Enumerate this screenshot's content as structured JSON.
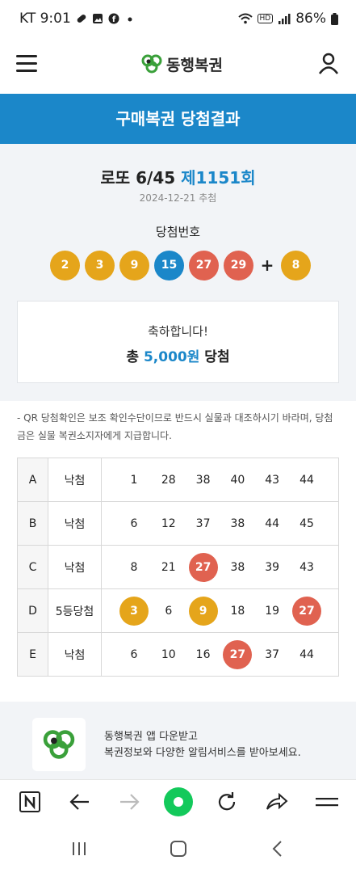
{
  "status_bar": {
    "carrier_time": "KT 9:01",
    "battery": "86%",
    "hd": "HD"
  },
  "header": {
    "logo_text": "동행복권"
  },
  "banner": {
    "title": "구매복권 당첨결과"
  },
  "draw": {
    "game": "로또 6/45",
    "round": "제1151회",
    "date": "2024-12-21 추첨",
    "numbers_label": "당첨번호",
    "numbers": [
      {
        "value": "2",
        "color": "#e5a51b"
      },
      {
        "value": "3",
        "color": "#e5a51b"
      },
      {
        "value": "9",
        "color": "#e5a51b"
      },
      {
        "value": "15",
        "color": "#1b87c9"
      },
      {
        "value": "27",
        "color": "#e06250"
      },
      {
        "value": "29",
        "color": "#e06250"
      }
    ],
    "plus": "+",
    "bonus": {
      "value": "8",
      "color": "#e5a51b"
    }
  },
  "result": {
    "congrats": "축하합니다!",
    "total_prefix": "총 ",
    "amount": "5,000원",
    "total_suffix": " 당첨"
  },
  "notice": {
    "text": "- QR 당첨확인은 보조 확인수단이므로 반드시 실물과 대조하시기 바라며, 당첨금은 실물 복권소지자에게 지급합니다."
  },
  "tickets": [
    {
      "id": "A",
      "result": "낙첨",
      "numbers": [
        {
          "v": "1",
          "hit": false
        },
        {
          "v": "28",
          "hit": false
        },
        {
          "v": "38",
          "hit": false
        },
        {
          "v": "40",
          "hit": false
        },
        {
          "v": "43",
          "hit": false
        },
        {
          "v": "44",
          "hit": false
        }
      ]
    },
    {
      "id": "B",
      "result": "낙첨",
      "numbers": [
        {
          "v": "6",
          "hit": false
        },
        {
          "v": "12",
          "hit": false
        },
        {
          "v": "37",
          "hit": false
        },
        {
          "v": "38",
          "hit": false
        },
        {
          "v": "44",
          "hit": false
        },
        {
          "v": "45",
          "hit": false
        }
      ]
    },
    {
      "id": "C",
      "result": "낙첨",
      "numbers": [
        {
          "v": "8",
          "hit": false
        },
        {
          "v": "21",
          "hit": false
        },
        {
          "v": "27",
          "hit": true,
          "color": "#e06250"
        },
        {
          "v": "38",
          "hit": false
        },
        {
          "v": "39",
          "hit": false
        },
        {
          "v": "43",
          "hit": false
        }
      ]
    },
    {
      "id": "D",
      "result": "5등당첨",
      "numbers": [
        {
          "v": "3",
          "hit": true,
          "color": "#e5a51b"
        },
        {
          "v": "6",
          "hit": false
        },
        {
          "v": "9",
          "hit": true,
          "color": "#e5a51b"
        },
        {
          "v": "18",
          "hit": false
        },
        {
          "v": "19",
          "hit": false
        },
        {
          "v": "27",
          "hit": true,
          "color": "#e06250"
        }
      ]
    },
    {
      "id": "E",
      "result": "낙첨",
      "numbers": [
        {
          "v": "6",
          "hit": false
        },
        {
          "v": "10",
          "hit": false
        },
        {
          "v": "16",
          "hit": false
        },
        {
          "v": "27",
          "hit": true,
          "color": "#e06250"
        },
        {
          "v": "37",
          "hit": false
        },
        {
          "v": "44",
          "hit": false
        }
      ]
    }
  ],
  "promo": {
    "line1": "동행복권 앱 다운받고",
    "line2": "복권정보와 다양한 알림서비스를 받아보세요."
  },
  "browser_bar": {
    "icons": [
      "naver-icon",
      "back-icon",
      "forward-icon",
      "home-icon",
      "refresh-icon",
      "share-icon",
      "menu-icon"
    ]
  },
  "colors": {
    "brand_blue": "#1b87c9",
    "ball_yellow": "#e5a51b",
    "ball_red": "#e06250",
    "logo_green": "#3aa03a"
  }
}
